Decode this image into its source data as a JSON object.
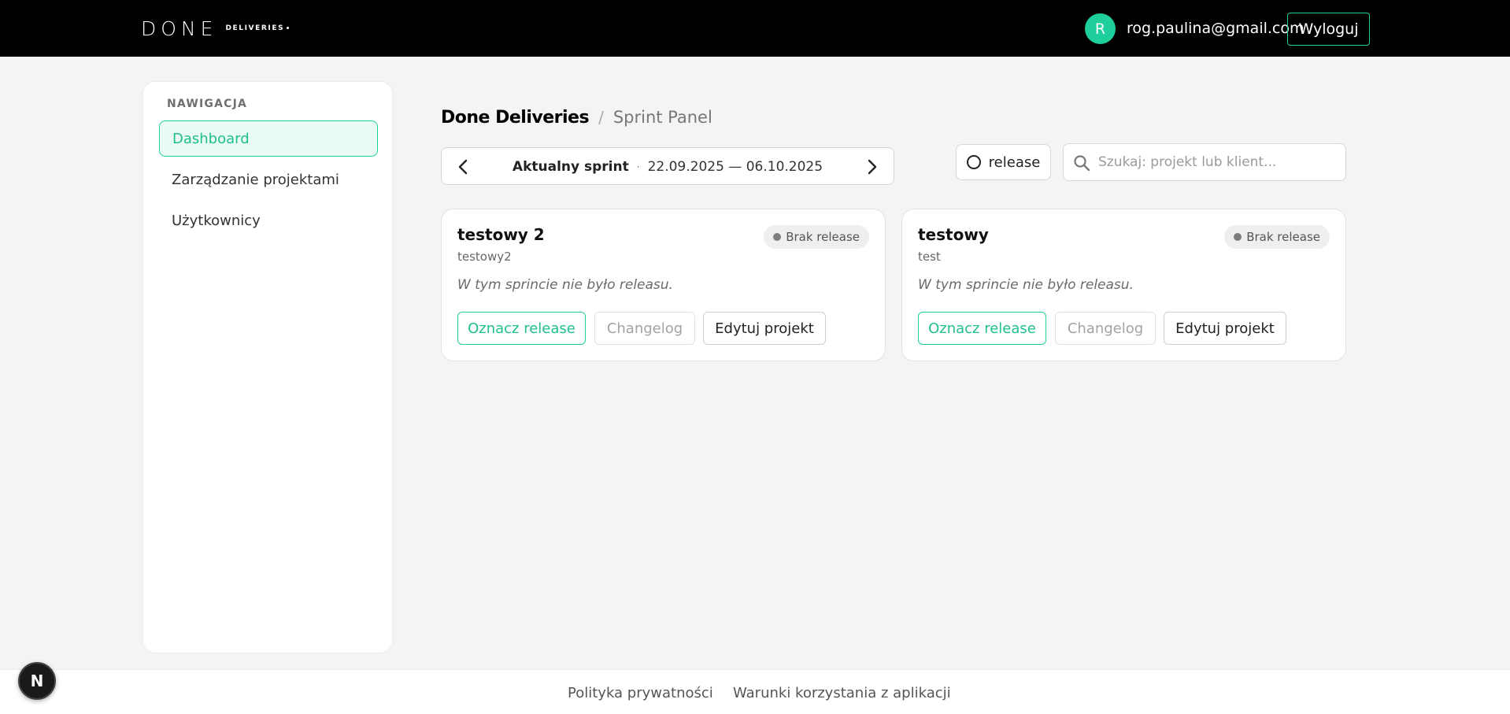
{
  "header": {
    "logo_main": "DONE",
    "logo_sub": "DELIVERIES",
    "avatar_initial": "R",
    "user_email": "rog.paulina@gmail.com",
    "logout_label": "Wyloguj",
    "accent_color": "#1fcf9b"
  },
  "sidebar": {
    "title": "NAWIGACJA",
    "items": [
      {
        "label": "Dashboard",
        "active": true
      },
      {
        "label": "Zarządzanie projektami",
        "active": false
      },
      {
        "label": "Użytkownicy",
        "active": false
      }
    ]
  },
  "breadcrumb": {
    "root": "Done Deliveries",
    "separator": "/",
    "current": "Sprint Panel"
  },
  "sprint": {
    "prev_icon": "chevron-left-icon",
    "label": "Aktualny sprint",
    "separator": "·",
    "range": "22.09.2025 — 06.10.2025",
    "next_icon": "chevron-right-icon"
  },
  "filter": {
    "release_label": "release"
  },
  "search": {
    "placeholder": "Szukaj: projekt lub klient..."
  },
  "projects": [
    {
      "name": "testowy 2",
      "client": "testowy2",
      "badge": "Brak release",
      "note": "W tym sprincie nie było releasu.",
      "actions": {
        "release": "Oznacz release",
        "changelog": "Changelog",
        "edit": "Edytuj projekt"
      }
    },
    {
      "name": "testowy",
      "client": "test",
      "badge": "Brak release",
      "note": "W tym sprincie nie było releasu.",
      "actions": {
        "release": "Oznacz release",
        "changelog": "Changelog",
        "edit": "Edytuj projekt"
      }
    }
  ],
  "footer": {
    "privacy": "Polityka prywatności",
    "terms": "Warunki korzystania z aplikacji"
  },
  "dev_badge": "N"
}
